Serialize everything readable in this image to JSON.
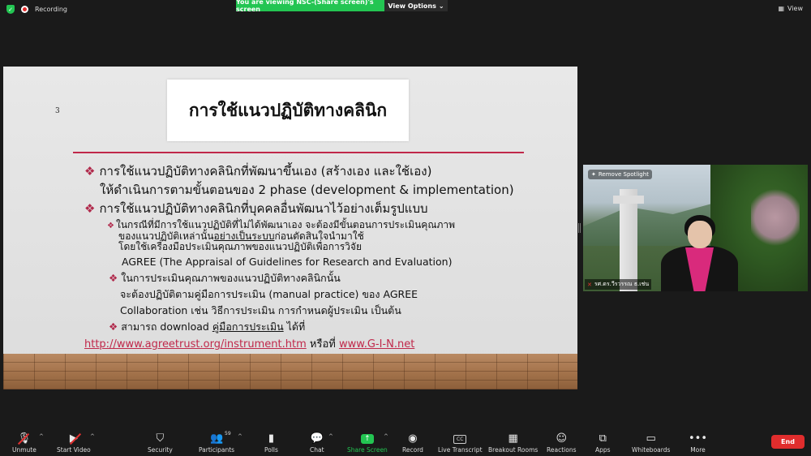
{
  "topbar": {
    "recording_label": "Recording",
    "share_banner": "You are viewing NSC-(Share screen)'s screen",
    "view_options": "View Options",
    "view_label": "View"
  },
  "slide": {
    "number": "3",
    "title": "การใช้แนวปฏิบัติทางคลินิก",
    "lines": {
      "a1": "การใช้แนวปฏิบัติทางคลินิกที่พัฒนาขึ้นเอง (สร้างเอง และใช้เอง)",
      "a2": "ให้ดำเนินการตามขั้นตอนของ 2 phase (development & implementation)",
      "b1": "การใช้แนวปฏิบัติทางคลินิกที่บุคคลอื่นพัฒนาไว้อย่างเต็มรูปแบบ",
      "c1": "ในกรณีที่มีการใช้แนวปฏิบัติที่ไม่ได้พัฒนาเอง จะต้องมีขั้นตอนการประเมินคุณภาพ",
      "c2_pre": "ของแนวปฏิบัติเหล่านั้น",
      "c2_ul": "อย่างเป็นระบบ",
      "c2_post": "ก่อนตัดสินใจนำมาใช้",
      "c3": "โดยใช้เครื่องมือประเมินคุณภาพของแนวปฏิบัติเพื่อการวิจัย",
      "c4": "AGREE (The Appraisal of Guidelines for Research and  Evaluation)",
      "d1": "ในการประเมินคุณภาพของแนวปฏิบัติทางคลินิกนั้น",
      "d2": "จะต้องปฏิบัติตามคู่มือการประเมิน (manual practice) ของ AGREE",
      "d3": "Collaboration เช่น วิธีการประเมิน การกำหนดผู้ประเมิน เป็นต้น",
      "e1_pre": "สามารถ download",
      "e1_ul": "คู่มือการประเมิน",
      "e1_post": "ได้ที่",
      "link1": "http://www.agreetrust.org/instrument.htm",
      "or": "หรือที่",
      "link2": "www.G-I-N.net"
    }
  },
  "video": {
    "spotlight_label": "Remove Spotlight",
    "participant_name": "รศ.ดร.วีรวรรณ ธ.เช่น"
  },
  "toolbar": {
    "unmute": "Unmute",
    "start_video": "Start Video",
    "security": "Security",
    "participants": "Participants",
    "participants_count": "59",
    "polls": "Polls",
    "chat": "Chat",
    "share_screen": "Share Screen",
    "record": "Record",
    "live_transcript": "Live Transcript",
    "breakout_rooms": "Breakout Rooms",
    "reactions": "Reactions",
    "apps": "Apps",
    "whiteboards": "Whiteboards",
    "more": "More",
    "end": "End"
  },
  "colors": {
    "share_green": "#23c552",
    "end_red": "#e02d2d",
    "slide_accent": "#c0284a"
  }
}
